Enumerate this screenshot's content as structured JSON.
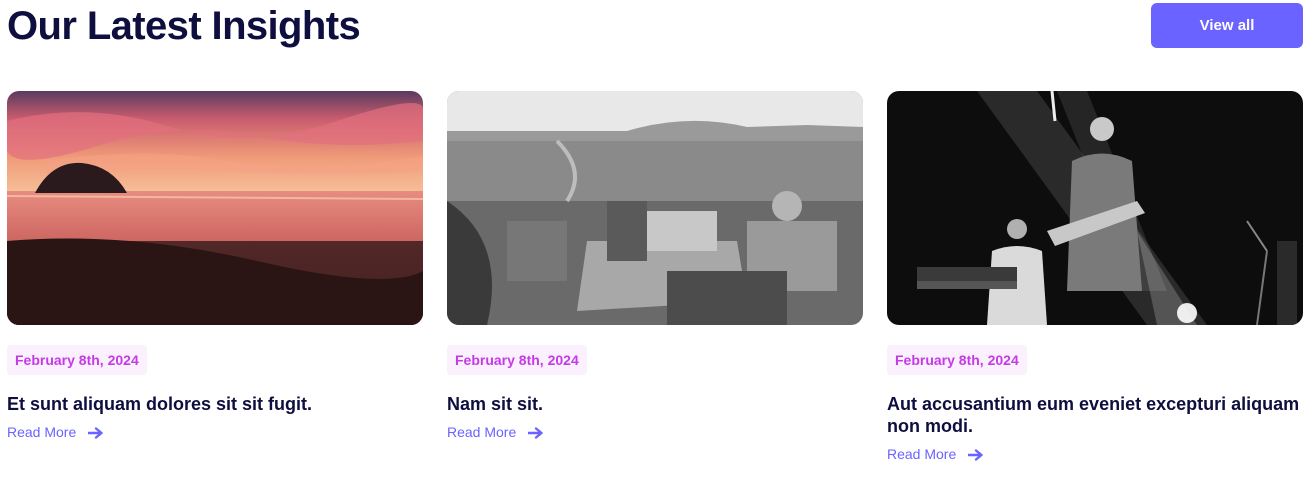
{
  "header": {
    "title": "Our Latest Insights",
    "view_all_label": "View all"
  },
  "cards": [
    {
      "image": "sunset-beach-photo",
      "date": "February 8th, 2024",
      "title": "Et sunt aliquam dolores sit sit fugit.",
      "read_more": "Read More",
      "icon": "arrow-right-icon"
    },
    {
      "image": "city-aerial-photo",
      "date": "February 8th, 2024",
      "title": "Nam sit sit.",
      "read_more": "Read More",
      "icon": "arrow-right-icon"
    },
    {
      "image": "concert-musicians-photo",
      "date": "February 8th, 2024",
      "title": "Aut accusantium eum eveniet excepturi aliquam non modi.",
      "read_more": "Read More",
      "icon": "arrow-right-icon"
    }
  ],
  "colors": {
    "heading": "#0e0e3f",
    "accent": "#6b63ff",
    "date_text": "#c43be6",
    "date_bg": "#fbf0fd"
  }
}
